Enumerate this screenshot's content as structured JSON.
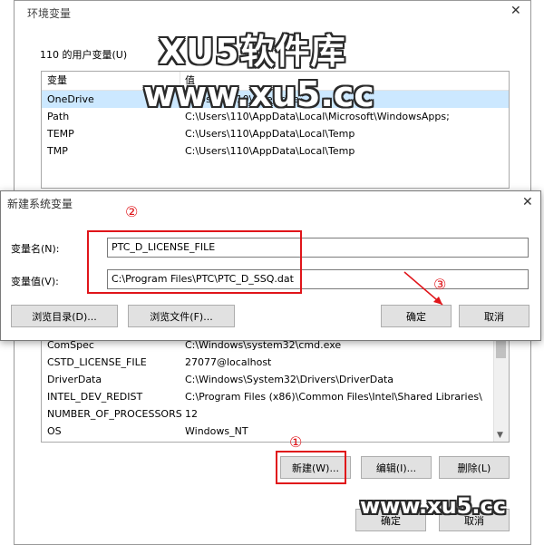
{
  "env_window": {
    "title": "环境变量",
    "user_section_label": "110 的用户变量(U)",
    "columns": [
      "变量",
      "值"
    ],
    "user_vars": [
      {
        "name": "OneDrive",
        "value": "C:\\Users\\110\\OneDrive"
      },
      {
        "name": "Path",
        "value": "C:\\Users\\110\\AppData\\Local\\Microsoft\\WindowsApps;"
      },
      {
        "name": "TEMP",
        "value": "C:\\Users\\110\\AppData\\Local\\Temp"
      },
      {
        "name": "TMP",
        "value": "C:\\Users\\110\\AppData\\Local\\Temp"
      }
    ],
    "system_vars": [
      {
        "name": "ComSpec",
        "value": "C:\\Windows\\system32\\cmd.exe"
      },
      {
        "name": "CSTD_LICENSE_FILE",
        "value": "27077@localhost"
      },
      {
        "name": "DriverData",
        "value": "C:\\Windows\\System32\\Drivers\\DriverData"
      },
      {
        "name": "INTEL_DEV_REDIST",
        "value": "C:\\Program Files (x86)\\Common Files\\Intel\\Shared Libraries\\"
      },
      {
        "name": "NUMBER_OF_PROCESSORS",
        "value": "12"
      },
      {
        "name": "OS",
        "value": "Windows_NT"
      }
    ],
    "new_button": "新建(W)...",
    "edit_button": "编辑(I)...",
    "delete_button": "删除(L)",
    "ok_button": "确定",
    "cancel_button": "取消"
  },
  "dialog": {
    "title": "新建系统变量",
    "name_label": "变量名(N):",
    "name_value": "PTC_D_LICENSE_FILE",
    "value_label": "变量值(V):",
    "value_value": "C:\\Program Files\\PTC\\PTC_D_SSQ.dat",
    "browse_dir_button": "浏览目录(D)...",
    "browse_file_button": "浏览文件(F)...",
    "ok_button": "确定",
    "cancel_button": "取消"
  },
  "annotations": {
    "step1": "①",
    "step2": "②",
    "step3": "③"
  },
  "watermark": {
    "brand": "XU5软件库",
    "url_top": "www.xu5.cc",
    "url_bottom": "www.xu5.cc"
  },
  "colors": {
    "annotation_red": "#e0151a",
    "selection_blue": "#cce8ff",
    "button_face": "#e1e1e1"
  }
}
